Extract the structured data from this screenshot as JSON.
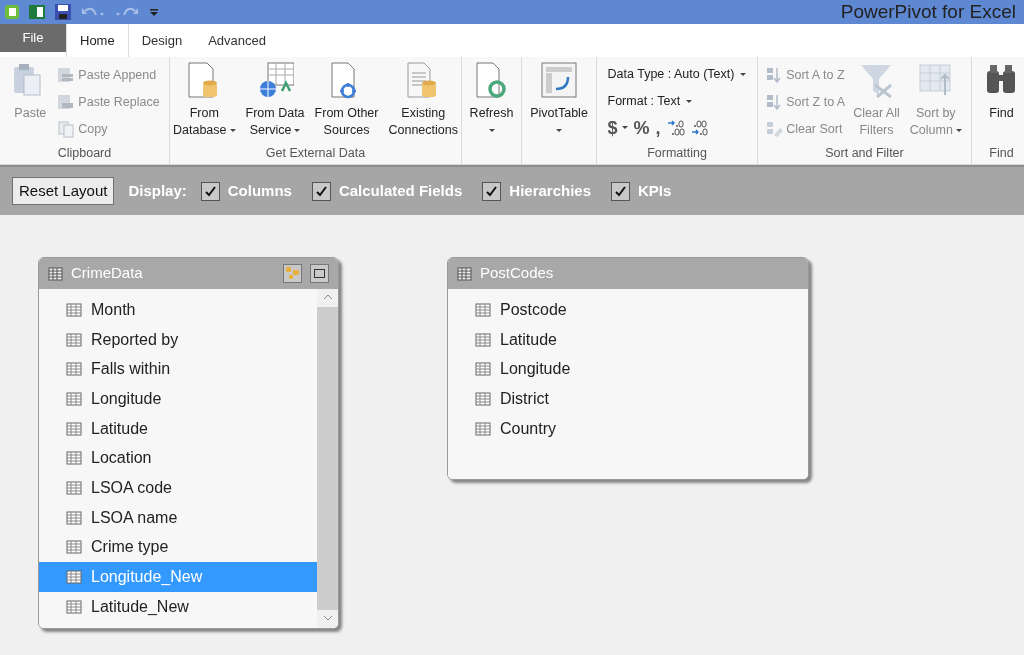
{
  "window": {
    "title": "PowerPivot for Excel"
  },
  "tabs": [
    {
      "label": "File",
      "kind": "file",
      "selected": false
    },
    {
      "label": "Home",
      "kind": "tab",
      "selected": true
    },
    {
      "label": "Design",
      "kind": "tab",
      "selected": false
    },
    {
      "label": "Advanced",
      "kind": "tab",
      "selected": false
    }
  ],
  "ribbon": [
    {
      "label": "Clipboard",
      "items": [
        {
          "kind": "large",
          "lines": [
            "Paste"
          ],
          "dropdown": false,
          "disabled": true
        },
        {
          "kind": "stack",
          "entries": [
            {
              "label": "Paste Append",
              "disabled": true
            },
            {
              "label": "Paste Replace",
              "disabled": true
            },
            {
              "label": "Copy",
              "disabled": true
            }
          ]
        }
      ]
    },
    {
      "label": "Get External Data",
      "items": [
        {
          "kind": "large",
          "lines": [
            "From",
            "Database"
          ],
          "dropdown": true,
          "disabled": false
        },
        {
          "kind": "large",
          "lines": [
            "From Data",
            "Service"
          ],
          "dropdown": true,
          "disabled": false
        },
        {
          "kind": "large",
          "lines": [
            "From Other",
            "Sources"
          ],
          "dropdown": false,
          "disabled": false
        },
        {
          "kind": "large",
          "lines": [
            "Existing",
            "Connections"
          ],
          "dropdown": false,
          "disabled": false
        }
      ]
    },
    {
      "items": [
        {
          "kind": "large",
          "lines": [
            "Refresh"
          ],
          "dropdown": true,
          "disabled": false
        }
      ]
    },
    {
      "items": [
        {
          "kind": "large",
          "lines": [
            "PivotTable"
          ],
          "dropdown": true,
          "disabled": false
        }
      ]
    },
    {
      "label": "Formatting",
      "items": [
        {
          "kind": "format",
          "data_type": "Data Type : Auto (Text)",
          "format": "Format : Text",
          "symbols": [
            "$",
            "%",
            ","
          ]
        }
      ]
    },
    {
      "label": "Sort and Filter",
      "items": [
        {
          "kind": "stack",
          "entries": [
            {
              "label": "Sort A to Z",
              "disabled": true
            },
            {
              "label": "Sort Z to A",
              "disabled": true
            },
            {
              "label": "Clear Sort",
              "disabled": true
            }
          ]
        },
        {
          "kind": "large",
          "lines": [
            "Clear All",
            "Filters"
          ],
          "dropdown": false,
          "disabled": true
        },
        {
          "kind": "large",
          "lines": [
            "Sort by",
            "Column"
          ],
          "dropdown": true,
          "disabled": true
        }
      ]
    },
    {
      "label": "Find",
      "items": [
        {
          "kind": "large",
          "lines": [
            "Find"
          ],
          "dropdown": false,
          "disabled": false
        }
      ]
    }
  ],
  "display_bar": {
    "button": "Reset Layout",
    "label": "Display:",
    "options": [
      {
        "label": "Columns",
        "checked": true
      },
      {
        "label": "Calculated Fields",
        "checked": true
      },
      {
        "label": "Hierarchies",
        "checked": true
      },
      {
        "label": "KPIs",
        "checked": true
      }
    ]
  },
  "tables": [
    {
      "title": "CrimeData",
      "header_buttons": true,
      "scrollbar": true,
      "columns": [
        {
          "name": "Month",
          "selected": false
        },
        {
          "name": "Reported by",
          "selected": false
        },
        {
          "name": "Falls within",
          "selected": false
        },
        {
          "name": "Longitude",
          "selected": false
        },
        {
          "name": "Latitude",
          "selected": false
        },
        {
          "name": "Location",
          "selected": false
        },
        {
          "name": "LSOA code",
          "selected": false
        },
        {
          "name": "LSOA name",
          "selected": false
        },
        {
          "name": "Crime type",
          "selected": false
        },
        {
          "name": "Longitude_New",
          "selected": true
        },
        {
          "name": "Latitude_New",
          "selected": false
        }
      ]
    },
    {
      "title": "PostCodes",
      "header_buttons": false,
      "scrollbar": false,
      "columns": [
        {
          "name": "Postcode",
          "selected": false
        },
        {
          "name": "Latitude",
          "selected": false
        },
        {
          "name": "Longitude",
          "selected": false
        },
        {
          "name": "District",
          "selected": false
        },
        {
          "name": "Country",
          "selected": false
        }
      ]
    }
  ]
}
